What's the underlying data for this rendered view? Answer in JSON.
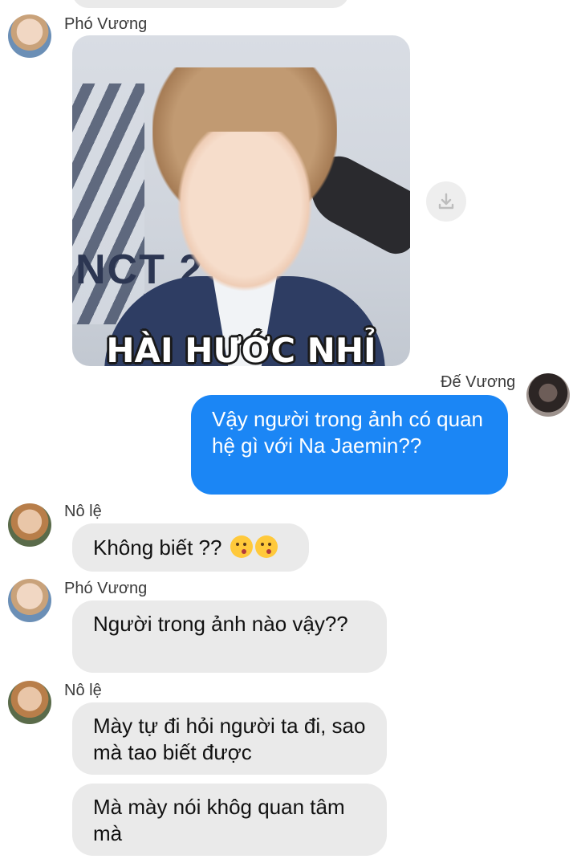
{
  "messages": [
    {
      "sender": "Phó Vương",
      "image_caption": "HÀI HƯỚC NHỈ",
      "image_text": "NCT 2"
    },
    {
      "sender": "Đế Vương",
      "text": "Vậy người trong ảnh có quan hệ gì với Na Jaemin??"
    },
    {
      "sender": "Nô lệ",
      "text": "Không biết ??"
    },
    {
      "sender": "Phó Vương",
      "text": "Người trong ảnh nào vậy??"
    },
    {
      "sender": "Nô lệ",
      "text": "Mày tự đi hỏi người ta đi, sao mà tao biết được"
    },
    {
      "sender": "Nô lệ",
      "text": "Mà mày nói khôg quan tâm mà"
    }
  ],
  "colors": {
    "outgoing_bubble": "#1b86f5",
    "incoming_bubble": "#eaeaea"
  },
  "icons": [
    "download-icon",
    "kissing-face-emoji"
  ]
}
